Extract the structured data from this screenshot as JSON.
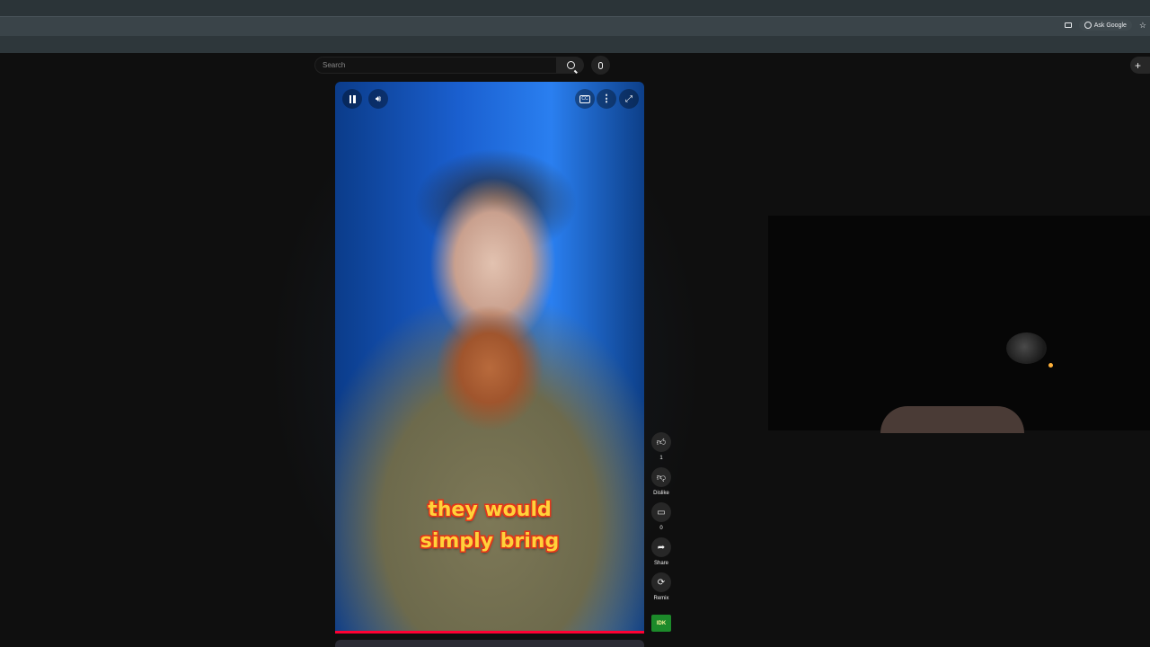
{
  "browser": {
    "ask_google_label": "Ask Google",
    "icons": [
      "cast-icon",
      "google-lens-icon",
      "star-icon"
    ]
  },
  "header": {
    "search_placeholder": "Search",
    "icons": [
      "search-icon",
      "mic-icon",
      "plus-icon"
    ]
  },
  "player": {
    "caption_line1": "they would",
    "caption_line2": "simply bring",
    "progress": 1.0,
    "accent": "#ff0033",
    "controls": [
      "pause-icon",
      "volume-icon",
      "captions-icon",
      "more-icon",
      "fullscreen-icon"
    ]
  },
  "actions": {
    "like_count": "1",
    "dislike_label": "Dislike",
    "comment_count": "0",
    "share_label": "Share",
    "remix_label": "Remix",
    "channel_badge": "IDK"
  },
  "colors": {
    "page_bg": "#0f0f0f",
    "chrome": "#3a4449",
    "button_bg": "#272727",
    "caption_fill": "#ffd23a",
    "caption_stroke": "#e2361b"
  }
}
